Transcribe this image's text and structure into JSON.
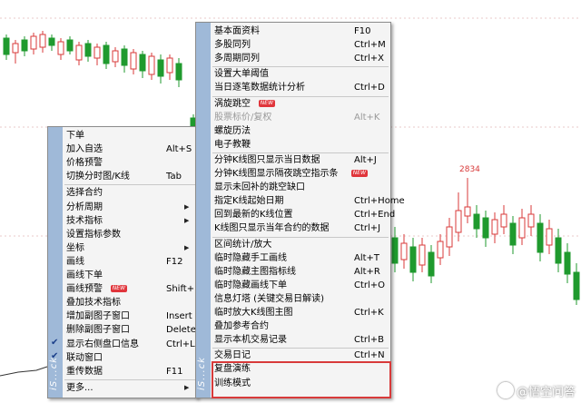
{
  "chart": {
    "price_label": "2834"
  },
  "left_menu": {
    "strip_text": "iS...ck",
    "items": [
      {
        "label": "下单",
        "shortcut": ""
      },
      {
        "label": "加入自选",
        "shortcut": "Alt+S"
      },
      {
        "label": "价格预警",
        "shortcut": ""
      },
      {
        "label": "切换分时图/K线",
        "shortcut": "Tab"
      },
      {
        "label": "选择合约",
        "shortcut": ""
      },
      {
        "label": "分析周期",
        "shortcut": "",
        "submenu": true
      },
      {
        "label": "技术指标",
        "shortcut": "",
        "submenu": true
      },
      {
        "label": "设置指标参数",
        "shortcut": ""
      },
      {
        "label": "坐标",
        "shortcut": "",
        "submenu": true
      },
      {
        "label": "画线",
        "shortcut": "F12"
      },
      {
        "label": "画线下单",
        "shortcut": ""
      },
      {
        "label": "画线预警",
        "shortcut": "Shift+F1",
        "badge": "NEW"
      },
      {
        "label": "叠加技术指标",
        "shortcut": ""
      },
      {
        "label": "增加副图子窗口",
        "shortcut": "Insert"
      },
      {
        "label": "删除副图子窗口",
        "shortcut": "Delete"
      },
      {
        "label": "显示右侧盘口信息",
        "shortcut": "Ctrl+L",
        "checked": true
      },
      {
        "label": "联动窗口",
        "shortcut": "",
        "checked": true
      },
      {
        "label": "重传数据",
        "shortcut": "F11"
      },
      {
        "label": "更多...",
        "shortcut": "",
        "submenu": true
      }
    ]
  },
  "right_menu": {
    "strip_text": "iS...ck",
    "items": [
      {
        "label": "基本面资料",
        "shortcut": "F10"
      },
      {
        "label": "多股同列",
        "shortcut": "Ctrl+M"
      },
      {
        "label": "多周期同列",
        "shortcut": "Ctrl+X"
      },
      {
        "label": "设置大单阈值",
        "shortcut": ""
      },
      {
        "label": "当日逐笔数据统计分析",
        "shortcut": "Ctrl+D"
      },
      {
        "label": "涡旋跳空",
        "shortcut": "",
        "badge": "NEW"
      },
      {
        "label": "股票标价/复权",
        "shortcut": "Alt+K",
        "disabled": true
      },
      {
        "label": "螺旋历法",
        "shortcut": ""
      },
      {
        "label": "电子教鞭",
        "shortcut": ""
      },
      {
        "label": "分钟K线图只显示当日数据",
        "shortcut": "Alt+J"
      },
      {
        "label": "分钟K线图显示隔夜跳空指示条",
        "shortcut": "",
        "badge": "NEW"
      },
      {
        "label": "显示未回补的跳空缺口",
        "shortcut": ""
      },
      {
        "label": "指定K线起始日期",
        "shortcut": "Ctrl+Home"
      },
      {
        "label": "回到最新的K线位置",
        "shortcut": "Ctrl+End"
      },
      {
        "label": "K线图只显示当年合约的数据",
        "shortcut": "Ctrl+J"
      },
      {
        "label": "区间统计/放大",
        "shortcut": ""
      },
      {
        "label": "临时隐藏手工画线",
        "shortcut": "Alt+T"
      },
      {
        "label": "临时隐藏主图指标线",
        "shortcut": "Alt+R"
      },
      {
        "label": "临时隐藏画线下单",
        "shortcut": "Ctrl+O"
      },
      {
        "label": "信息灯塔 (关键交易日解读)",
        "shortcut": ""
      },
      {
        "label": "临时放大K线图主图",
        "shortcut": "Ctrl+K"
      },
      {
        "label": "叠加参考合约",
        "shortcut": ""
      },
      {
        "label": "显示本机交易记录",
        "shortcut": "Ctrl+B"
      },
      {
        "label": "交易日记",
        "shortcut": "Ctrl+N"
      },
      {
        "label": "复盘演练",
        "shortcut": ""
      },
      {
        "label": "训练模式",
        "shortcut": ""
      }
    ]
  },
  "watermark": {
    "text": "@悟空问答"
  },
  "colors": {
    "up": "#d83a3a",
    "down": "#1f9a2e",
    "highlight": "#d83a3a",
    "menu_strip": "#9fb9d8"
  }
}
